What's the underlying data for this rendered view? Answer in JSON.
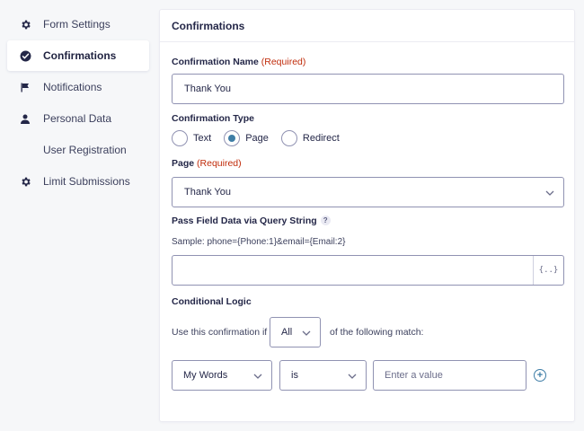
{
  "sidebar": {
    "items": [
      {
        "label": "Form Settings",
        "icon": "gear-icon"
      },
      {
        "label": "Confirmations",
        "icon": "check-circle-icon",
        "active": true
      },
      {
        "label": "Notifications",
        "icon": "flag-icon"
      },
      {
        "label": "Personal Data",
        "icon": "user-icon"
      },
      {
        "label": "User Registration",
        "icon": ""
      },
      {
        "label": "Limit Submissions",
        "icon": "gear-icon"
      }
    ]
  },
  "panel": {
    "title": "Confirmations",
    "confirmation_name": {
      "label": "Confirmation Name",
      "required": "(Required)",
      "value": "Thank You"
    },
    "confirmation_type": {
      "label": "Confirmation Type",
      "options": [
        "Text",
        "Page",
        "Redirect"
      ],
      "selected": "Page"
    },
    "page": {
      "label": "Page",
      "required": "(Required)",
      "value": "Thank You"
    },
    "query_string": {
      "label": "Pass Field Data via Query String",
      "help": "?",
      "sample": "Sample: phone={Phone:1}&email={Email:2}",
      "value": "",
      "merge_tag_label": "{..}"
    },
    "conditional_logic": {
      "label": "Conditional Logic",
      "prefix": "Use this confirmation if",
      "match": "All",
      "suffix": "of the following match:",
      "rule": {
        "field": "My Words",
        "operator": "is",
        "value_placeholder": "Enter a value",
        "add": "+"
      }
    }
  },
  "colors": {
    "accent": "#3e7da6",
    "required": "#c02b0a",
    "text": "#242748",
    "border": "#9092b2"
  }
}
